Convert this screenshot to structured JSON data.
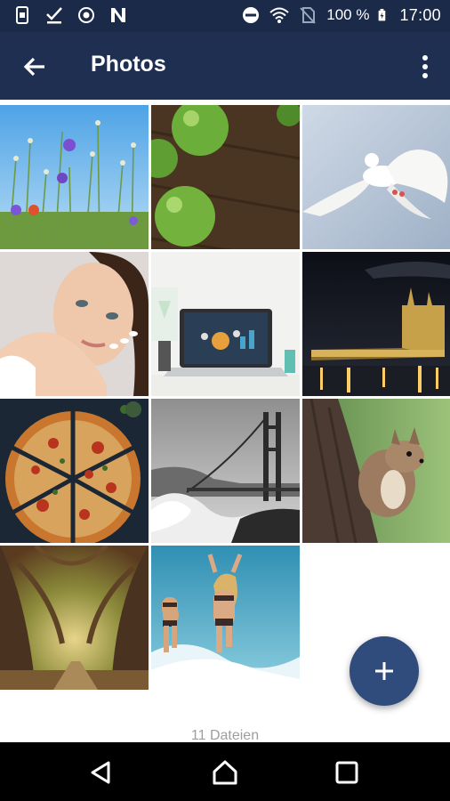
{
  "status_bar": {
    "battery_text": "100 %",
    "time": "17:00",
    "icons_left": [
      "sim-icon",
      "download-check-icon",
      "shield-icon",
      "n-icon"
    ],
    "icons_right": [
      "dnd-icon",
      "wifi-icon",
      "no-sim-icon",
      "battery-icon"
    ]
  },
  "app_bar": {
    "title": "Photos",
    "back_icon": "arrow-left-icon",
    "menu_icon": "more-vert-icon"
  },
  "grid": {
    "photos": [
      {
        "subject": "wildflowers"
      },
      {
        "subject": "green-apples"
      },
      {
        "subject": "white-dove"
      },
      {
        "subject": "woman-portrait"
      },
      {
        "subject": "laptop-desk"
      },
      {
        "subject": "notre-dame-night"
      },
      {
        "subject": "pizza"
      },
      {
        "subject": "golden-gate-bridge"
      },
      {
        "subject": "squirrel"
      },
      {
        "subject": "forest-tunnel"
      },
      {
        "subject": "beach-girls"
      }
    ]
  },
  "footer": {
    "file_count": "11 Dateien"
  },
  "fab": {
    "icon": "plus-icon"
  },
  "nav_bar": {
    "icons": [
      "back-triangle-icon",
      "home-icon",
      "recents-icon"
    ]
  },
  "colors": {
    "status_bar": "#1b2a49",
    "app_bar": "#1e2f52",
    "fab": "#2f4c7c",
    "nav_bar": "#000000"
  }
}
